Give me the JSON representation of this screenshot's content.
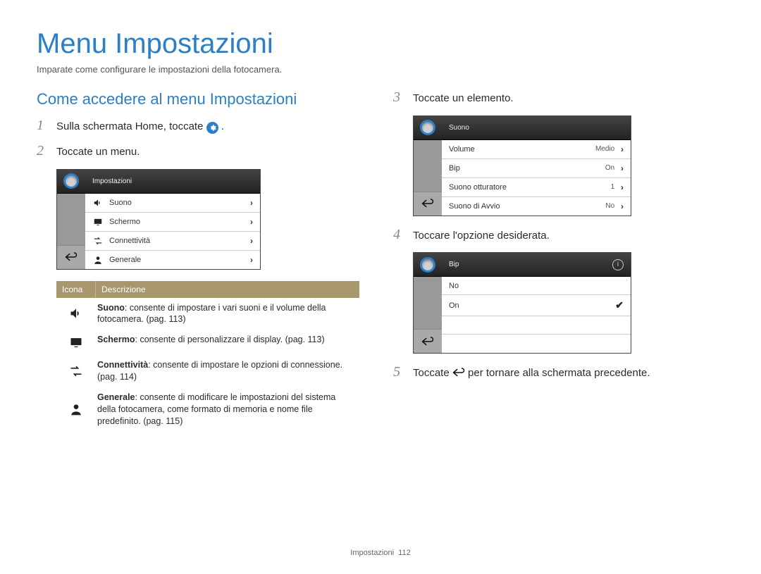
{
  "title": "Menu Impostazioni",
  "subtitle": "Imparate come configurare le impostazioni della fotocamera.",
  "section_heading": "Come accedere al menu Impostazioni",
  "steps": {
    "s1_pre": "Sulla schermata Home, toccate ",
    "s1_post": " .",
    "s2": "Toccate un menu.",
    "s3": "Toccate un elemento.",
    "s4": "Toccare l'opzione desiderata.",
    "s5_pre": "Toccate ",
    "s5_post": " per tornare alla schermata precedente."
  },
  "lcd1": {
    "title": "Impostazioni",
    "rows": [
      {
        "label": "Suono"
      },
      {
        "label": "Schermo"
      },
      {
        "label": "Connettività"
      },
      {
        "label": "Generale"
      }
    ]
  },
  "lcd2": {
    "title": "Suono",
    "rows": [
      {
        "label": "Volume",
        "value": "Medio"
      },
      {
        "label": "Bip",
        "value": "On"
      },
      {
        "label": "Suono otturatore",
        "value": "1"
      },
      {
        "label": "Suono di Avvio",
        "value": "No"
      }
    ]
  },
  "lcd3": {
    "title": "Bip",
    "rows": [
      {
        "label": "No"
      },
      {
        "label": "On"
      }
    ]
  },
  "table": {
    "head_icon": "Icona",
    "head_desc": "Descrizione",
    "rows": [
      {
        "bold": "Suono",
        "text": ": consente di impostare i vari suoni e il volume della fotocamera. (pag. 113)"
      },
      {
        "bold": "Schermo",
        "text": ": consente di personalizzare il display. (pag. 113)"
      },
      {
        "bold": "Connettività",
        "text": ": consente di impostare le opzioni di connessione. (pag. 114)"
      },
      {
        "bold": "Generale",
        "text": ": consente di modificare le impostazioni del sistema della fotocamera, come formato di memoria e nome file predefinito. (pag. 115)"
      }
    ]
  },
  "footer_label": "Impostazioni",
  "footer_page": "112"
}
